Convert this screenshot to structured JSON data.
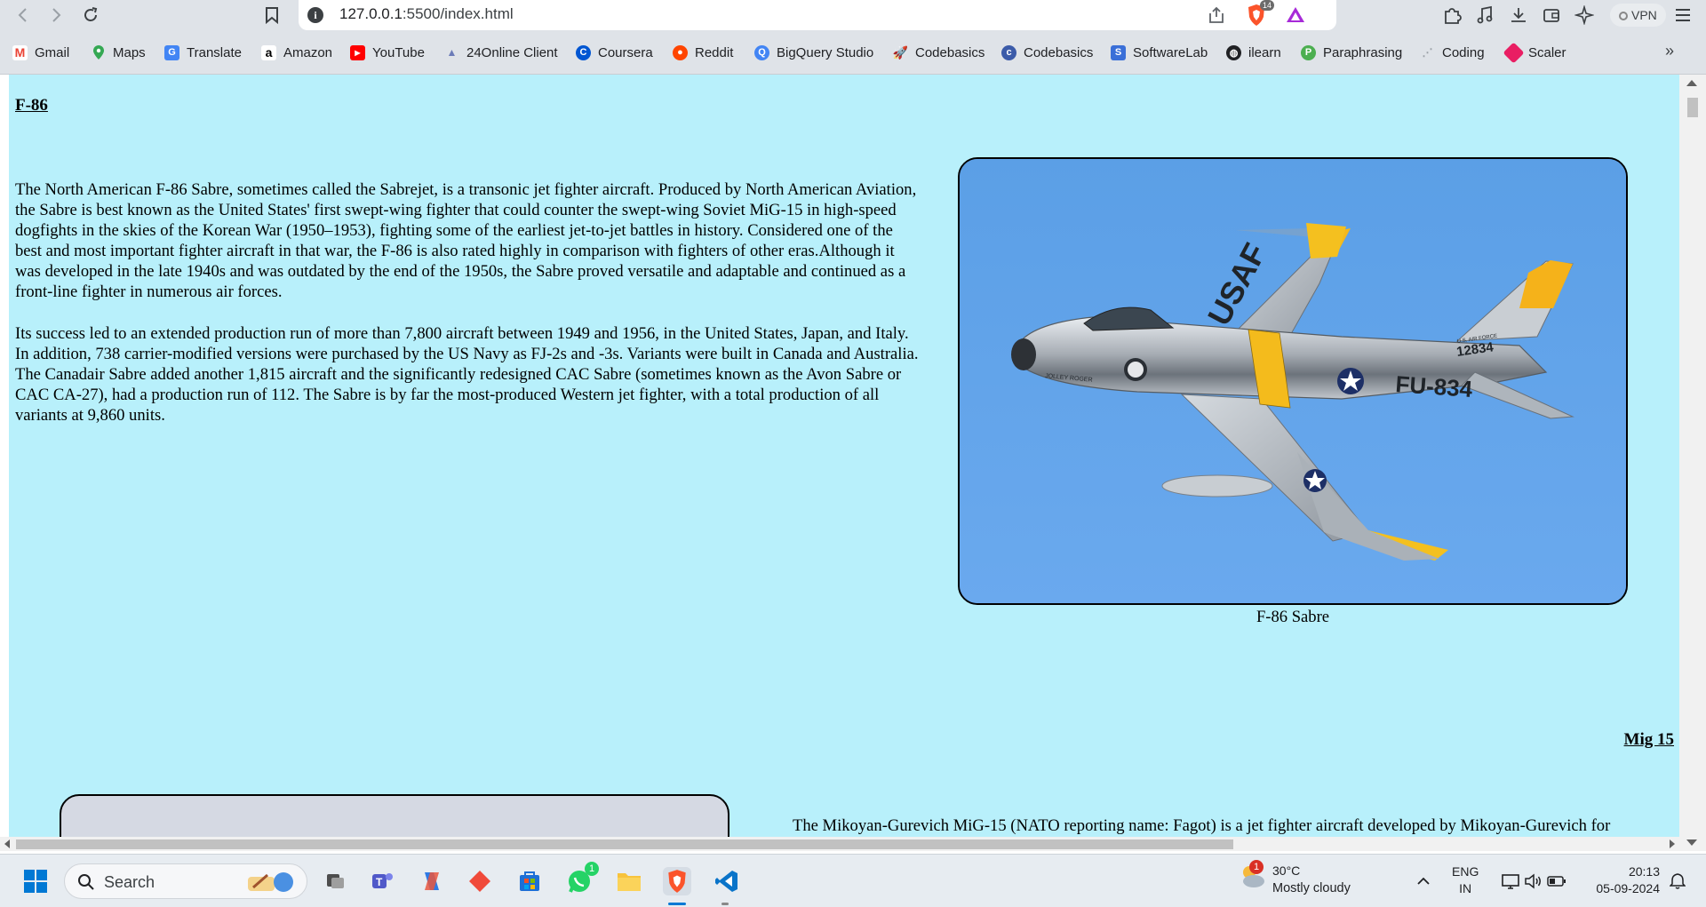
{
  "browser": {
    "url_host": "127.0.0.1",
    "url_path": ":5500/index.html",
    "brave_shield_count": "14",
    "vpn_label": "VPN"
  },
  "bookmarks": [
    {
      "label": "Gmail",
      "icon": "gmail-icon",
      "color": "#ea4335"
    },
    {
      "label": "Maps",
      "icon": "maps-icon",
      "color": "#34a853"
    },
    {
      "label": "Translate",
      "icon": "translate-icon",
      "color": "#4285f4"
    },
    {
      "label": "Amazon",
      "icon": "amazon-icon",
      "color": "#000000"
    },
    {
      "label": "YouTube",
      "icon": "youtube-icon",
      "color": "#ff0000"
    },
    {
      "label": "24Online Client",
      "icon": "24online-icon",
      "color": "#6b7bb8"
    },
    {
      "label": "Coursera",
      "icon": "coursera-icon",
      "color": "#0056d2"
    },
    {
      "label": "Reddit",
      "icon": "reddit-icon",
      "color": "#ff4500"
    },
    {
      "label": "BigQuery Studio",
      "icon": "bigquery-icon",
      "color": "#4285f4"
    },
    {
      "label": "Codebasics",
      "icon": "codebasics-rocket-icon",
      "color": "#1a73e8"
    },
    {
      "label": "Codebasics",
      "icon": "codebasics-icon",
      "color": "#3b5ba9"
    },
    {
      "label": "SoftwareLab",
      "icon": "softwarelab-icon",
      "color": "#3a6fd8"
    },
    {
      "label": "ilearn",
      "icon": "ilearn-icon",
      "color": "#202124"
    },
    {
      "label": "Paraphrasing",
      "icon": "paraphrasing-icon",
      "color": "#4caf50"
    },
    {
      "label": "Coding",
      "icon": "coding-icon",
      "color": "#9aa0a6"
    },
    {
      "label": "Scaler",
      "icon": "scaler-icon",
      "color": "#e91e63"
    }
  ],
  "page": {
    "section1": {
      "title": "F-86",
      "para1": "The North American F-86 Sabre, sometimes called the Sabrejet, is a transonic jet fighter aircraft. Produced by North American Aviation, the Sabre is best known as the United States' first swept-wing fighter that could counter the swept-wing Soviet MiG-15 in high-speed dogfights in the skies of the Korean War (1950–1953), fighting some of the earliest jet-to-jet battles in history. Considered one of the best and most important fighter aircraft in that war, the F-86 is also rated highly in comparison with fighters of other eras.Although it was developed in the late 1940s and was outdated by the end of the 1950s, the Sabre proved versatile and adaptable and continued as a front-line fighter in numerous air forces.",
      "para2": "Its success led to an extended production run of more than 7,800 aircraft between 1949 and 1956, in the United States, Japan, and Italy. In addition, 738 carrier-modified versions were purchased by the US Navy as FJ-2s and -3s. Variants were built in Canada and Australia. The Canadair Sabre added another 1,815 aircraft and the significantly redesigned CAC Sabre (sometimes known as the Avon Sabre or CAC CA-27), had a production run of 112. The Sabre is by far the most-produced Western jet fighter, with a total production of all variants at 9,860 units.",
      "image_caption": "F-86 Sabre",
      "plane_markings": {
        "wing": "USAF",
        "tail_number": "FU-834",
        "tail_code": "12834",
        "tail_text": "U.S. AIR FORCE",
        "nose_text": "JOLLEY ROGER"
      }
    },
    "section2": {
      "title": "Mig 15",
      "para1": "The Mikoyan-Gurevich MiG-15 (NATO reporting name: Fagot) is a jet fighter aircraft developed by Mikoyan-Gurevich for"
    },
    "background_color": "#b8f0fb"
  },
  "taskbar": {
    "search_label": "Search",
    "whatsapp_badge": "1",
    "weather_badge": "1",
    "temperature": "30°C",
    "weather": "Mostly cloudy",
    "lang_top": "ENG",
    "lang_bottom": "IN",
    "time": "20:13",
    "date": "05-09-2024"
  }
}
